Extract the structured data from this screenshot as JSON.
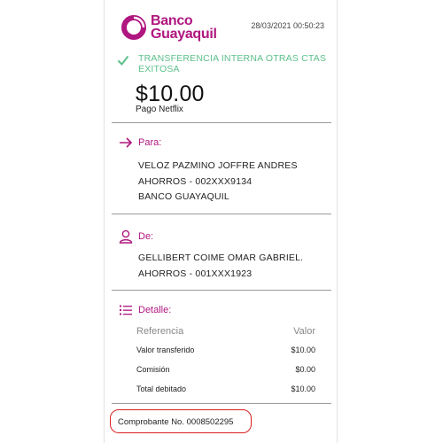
{
  "header": {
    "brand_line1": "Banco",
    "brand_line2": "Guayaquil",
    "timestamp": "28/03/2021 00:50:23"
  },
  "status": {
    "line1": "TRANSFERENCIA INTERNA OTRAS CTAS",
    "line2": "EXITOSA"
  },
  "amount": "$10.00",
  "concept": "Pago Netflix",
  "to_section": {
    "label": "Para:",
    "lines": [
      "VELOZ PAZMINO JOFFRE ANDRES",
      "AHORROS - 002XXX9134",
      "BANCO GUAYAQUIL"
    ]
  },
  "from_section": {
    "label": "De:",
    "lines": [
      "GELLIBERT COIME OMAR GABRIEL.",
      "AHORROS - 001XXX1923"
    ]
  },
  "detail_section": {
    "label": "Detalle:",
    "header": {
      "label": "Referencia",
      "value": "Valor"
    },
    "rows": [
      {
        "label": "Valor transferido",
        "value": "$10.00"
      },
      {
        "label": "Comisión",
        "value": "$0.00"
      },
      {
        "label": "Total debitado",
        "value": "$10.00"
      }
    ]
  },
  "voucher": "Comprobante No. 0008502295",
  "colors": {
    "brand": "#b0167f",
    "success": "#5cc08a",
    "highlight": "#d91f1f"
  },
  "icons": {
    "logo": "banco-guayaquil-logo",
    "status": "check-icon",
    "to": "arrow-right-icon",
    "from": "user-icon",
    "detail": "list-icon"
  }
}
